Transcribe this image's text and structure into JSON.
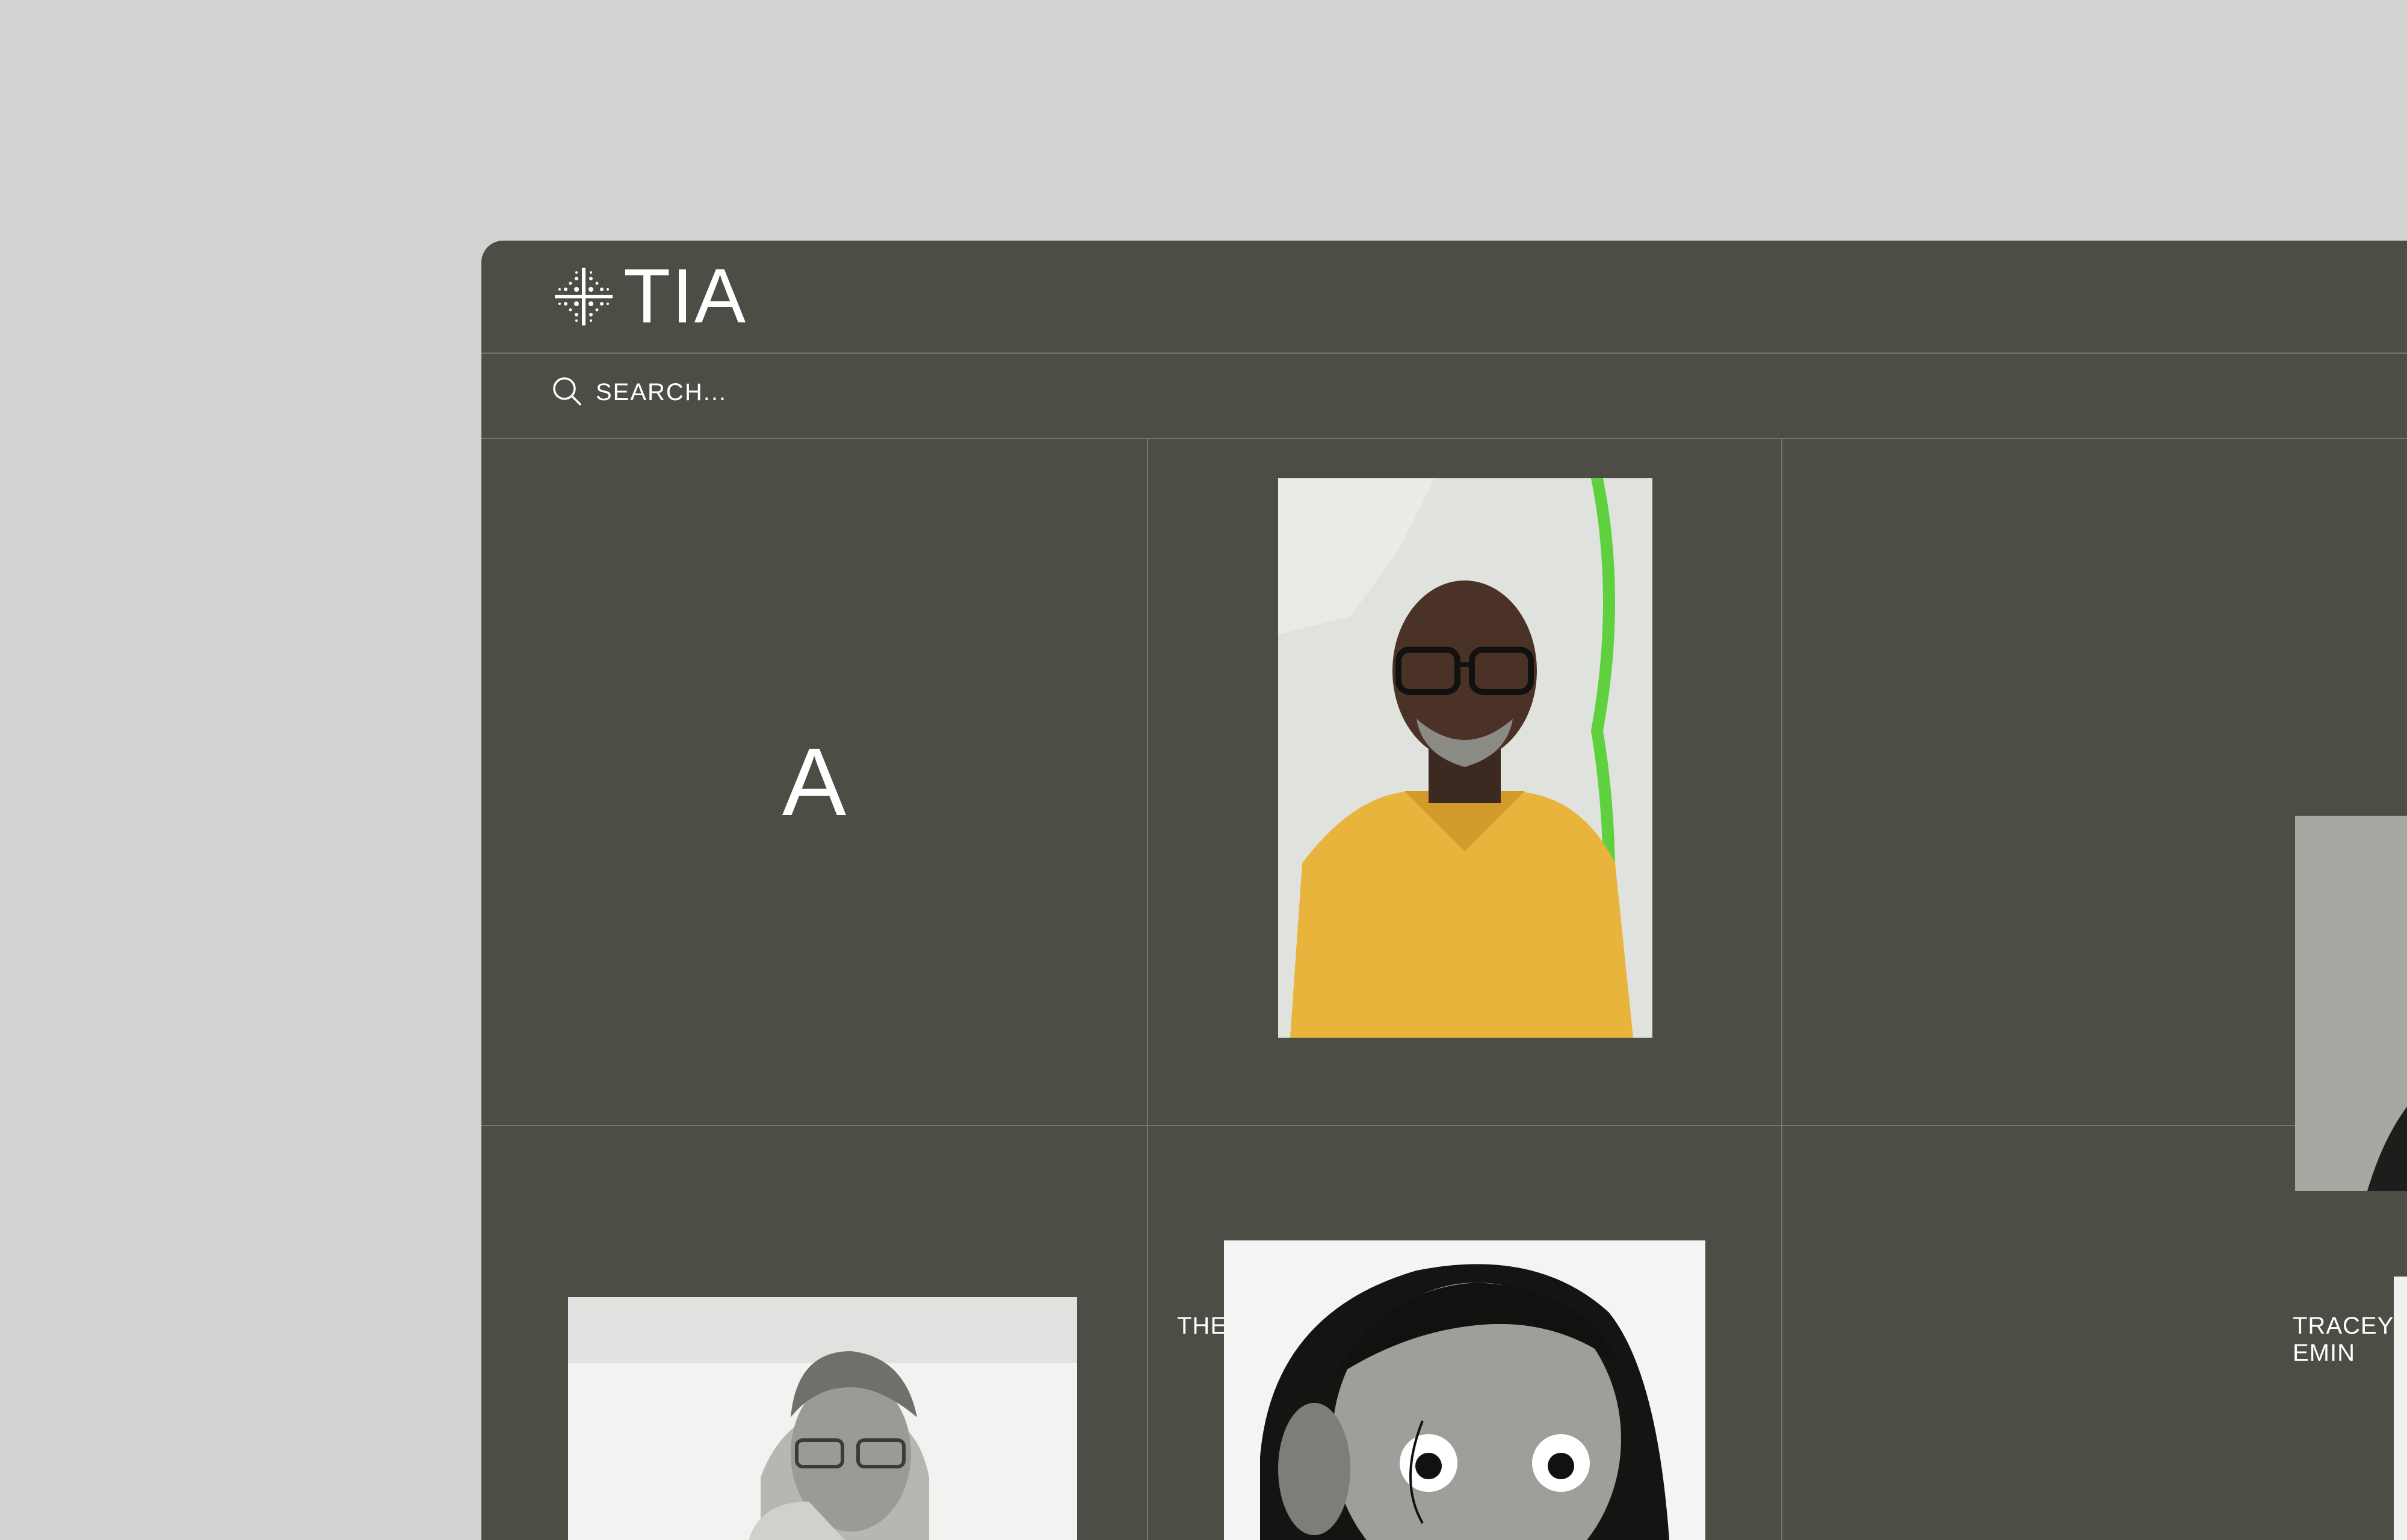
{
  "app": {
    "logo_text": "TIA"
  },
  "search": {
    "placeholder": "SEARCH..."
  },
  "grid": {
    "section_letter": "A",
    "artists": [
      {
        "name": "THEASTER GATES"
      },
      {
        "name": "TRACEY EMIN"
      }
    ]
  },
  "icons": {
    "logo": "sparkle-dot-grid-icon",
    "search": "search-icon"
  },
  "colors": {
    "page_background": "#d2d2d2",
    "window_background": "#4d4c45",
    "divider": "#75746d",
    "text": "#ffffff"
  }
}
